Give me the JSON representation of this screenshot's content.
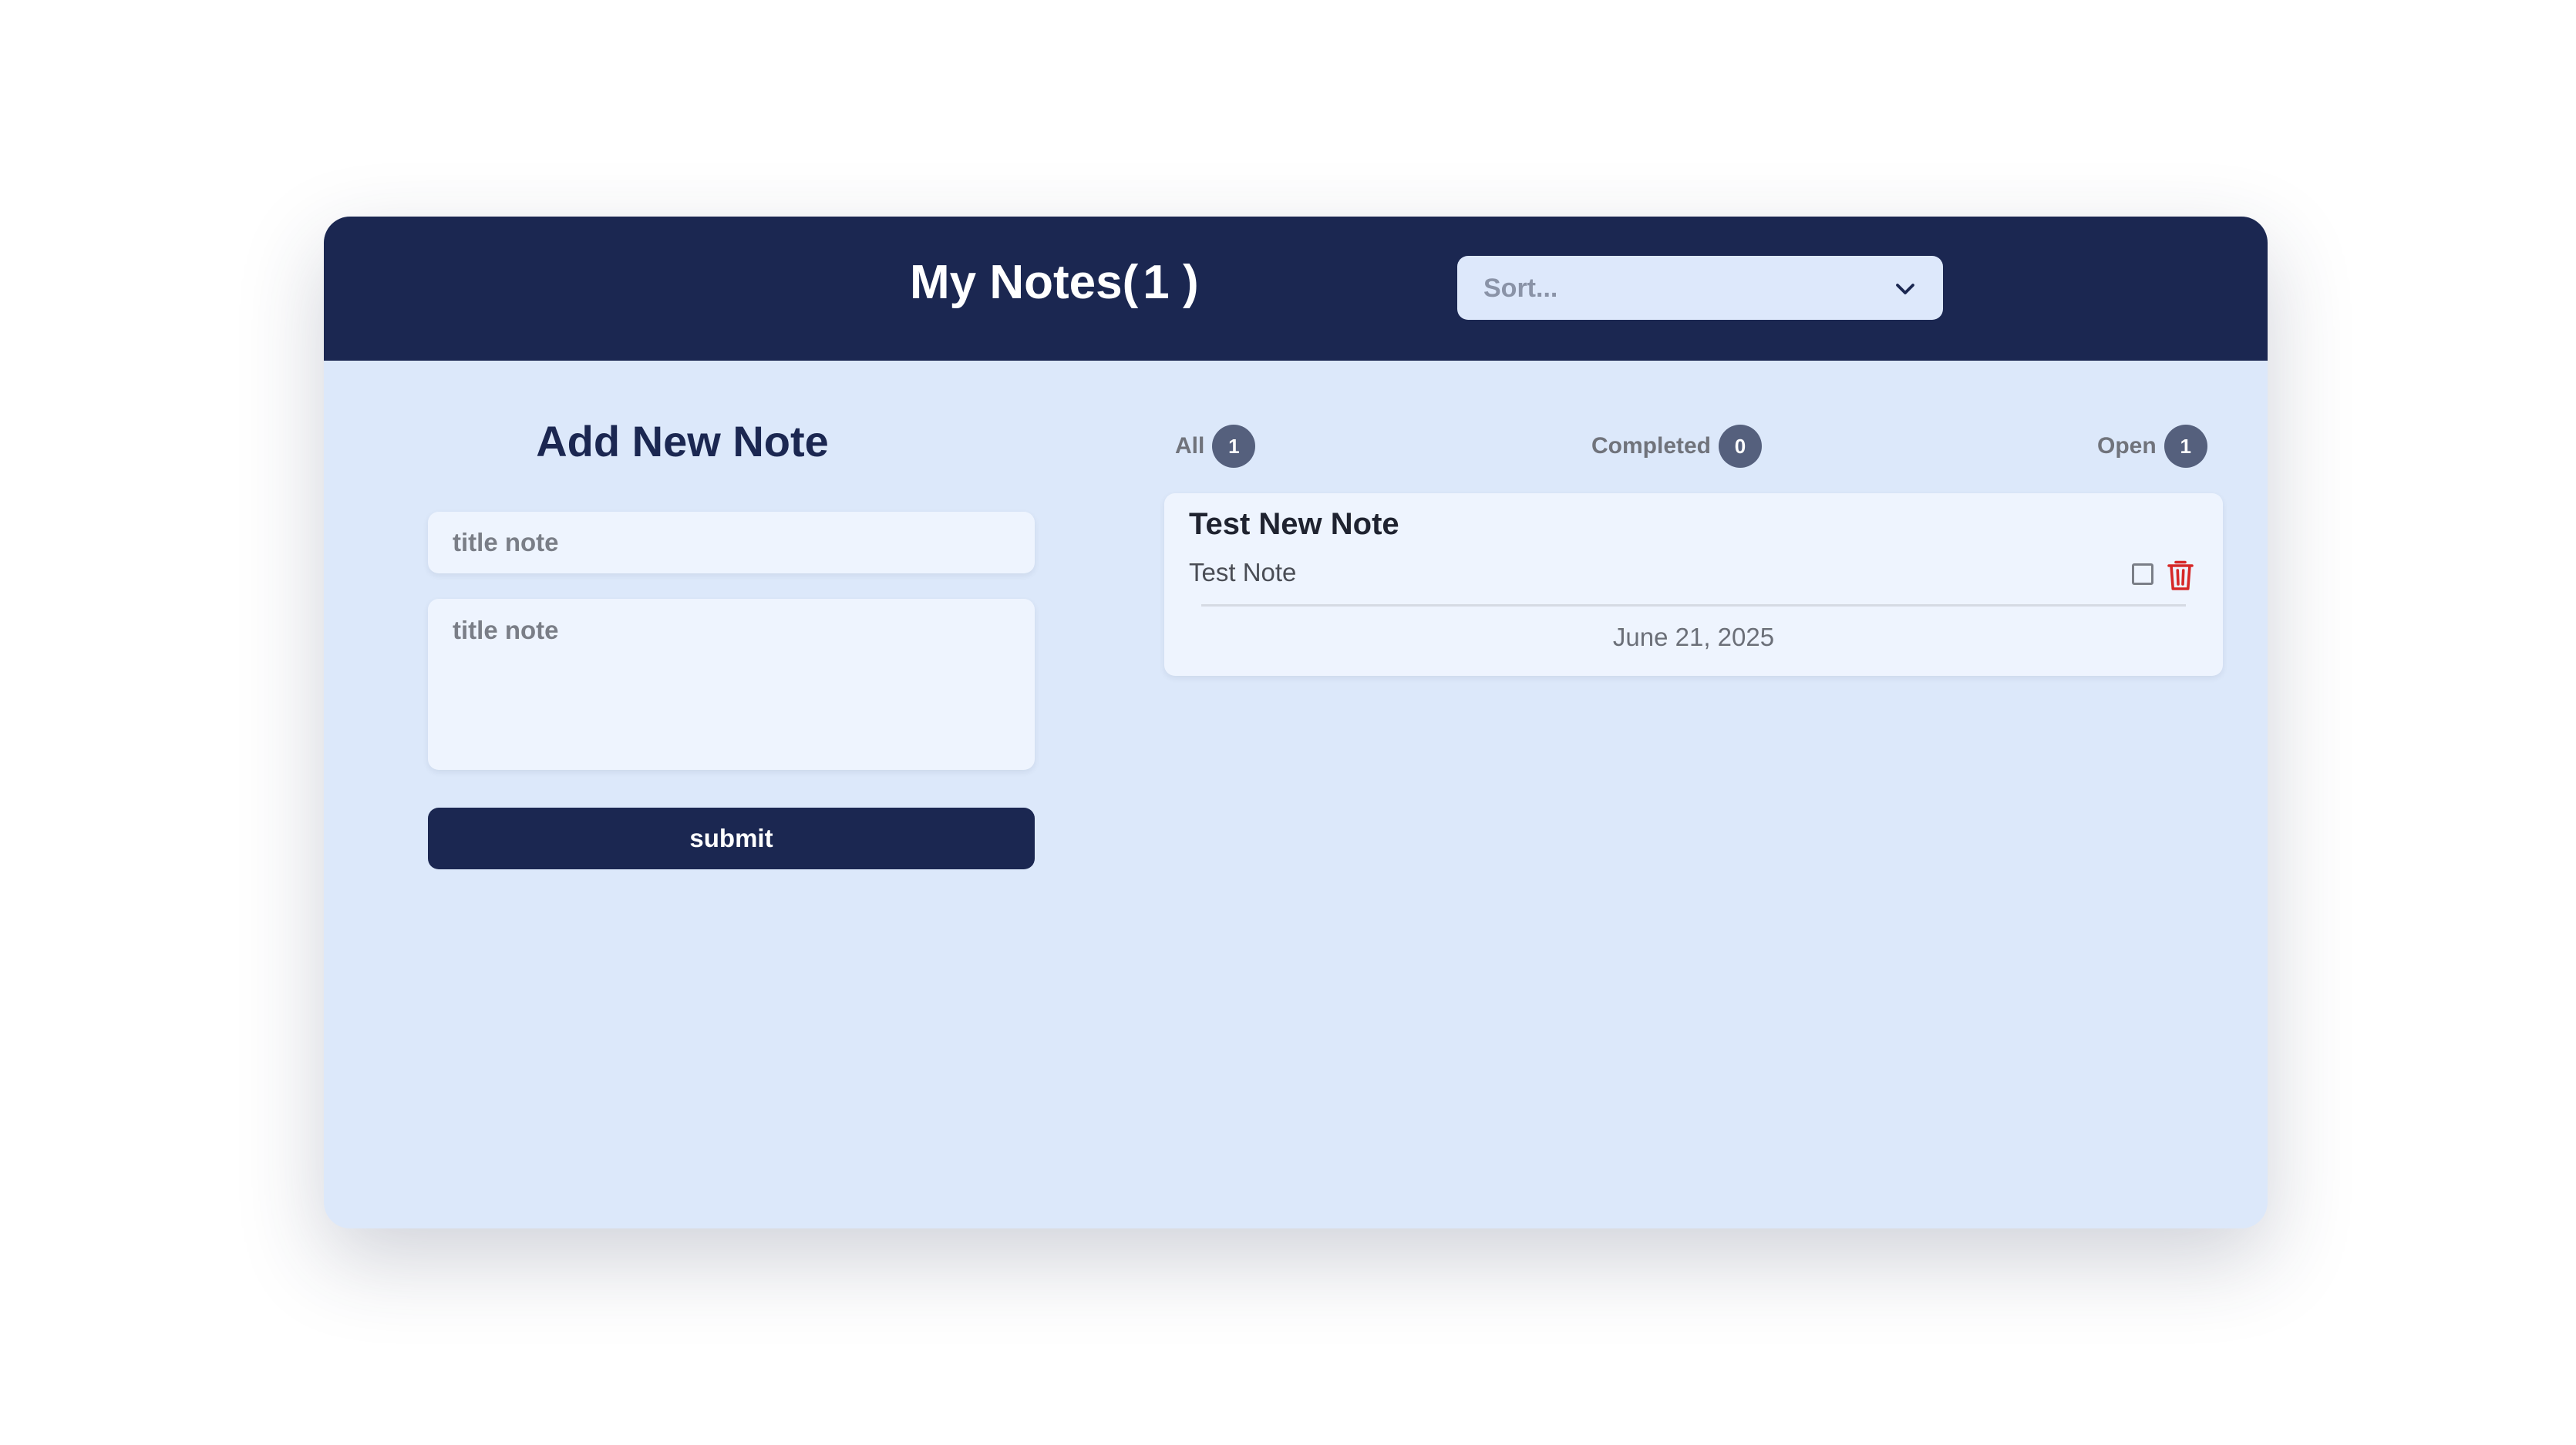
{
  "header": {
    "title": "My Notes(",
    "count": "1 )",
    "sort_placeholder": "Sort..."
  },
  "form": {
    "heading": "Add New Note",
    "title_placeholder": "title note",
    "body_placeholder": "title note",
    "submit_label": "submit"
  },
  "filters": [
    {
      "label": "All",
      "count": "1"
    },
    {
      "label": "Completed",
      "count": "0"
    },
    {
      "label": "Open",
      "count": "1"
    }
  ],
  "notes": [
    {
      "title": "Test New Note",
      "body": "Test Note",
      "date": "June 21, 2025",
      "completed": false
    }
  ],
  "colors": {
    "primary": "#1b2751",
    "background": "#dce8fa",
    "card": "#eef4fe",
    "badge": "#55607d",
    "delete": "#d62828"
  },
  "icons": [
    "chevron-down-icon",
    "checkbox-icon",
    "trash-icon"
  ]
}
